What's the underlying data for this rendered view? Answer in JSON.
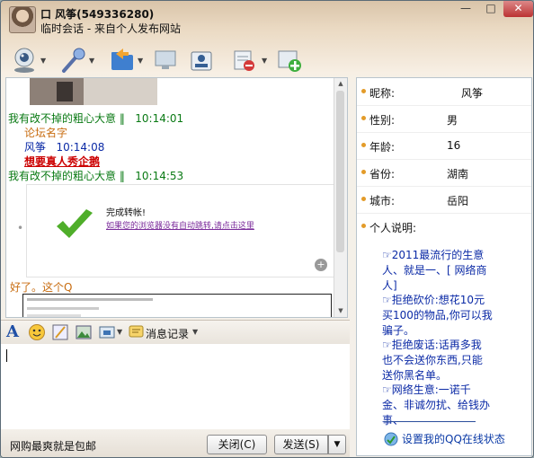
{
  "window": {
    "title_name": "口 风筝(549336280)",
    "subtitle": "临时会话 - 来自个人发布网站",
    "min_glyph": "—",
    "max_glyph": "□",
    "close_glyph": "✕"
  },
  "chat": {
    "messages": [
      {
        "sender": "我有改不掉的粗心大意 ‖",
        "time": "10:14:01"
      },
      {
        "text": "论坛名字"
      },
      {
        "sender": "风筝",
        "time": "10:14:08"
      },
      {
        "text": "想要真人秀企鹅"
      },
      {
        "sender": "我有改不掉的粗心大意 ‖",
        "time": "10:14:53"
      },
      {
        "text": "好了。这个Q"
      }
    ],
    "card": {
      "title": "完成转帐!",
      "link": "如果您的浏览器没有自动跳转,请点击这里"
    }
  },
  "format_toolbar": {
    "history_label": "消息记录"
  },
  "bottom": {
    "ad_text": "网购最爽就是包邮",
    "close_label": "关闭(C)",
    "send_label": "发送(S)"
  },
  "profile": {
    "nickname_label": "昵称:",
    "nickname": "风筝",
    "gender_label": "性别:",
    "gender": "男",
    "age_label": "年龄:",
    "age": "16",
    "province_label": "省份:",
    "province": "湖南",
    "city_label": "城市:",
    "city": "岳阳",
    "desc_label": "个人说明:",
    "desc_lines": [
      "☞2011最流行的生意",
      "人、就是一、[ 网络商",
      "人]",
      "☞拒绝砍价:想花10元",
      "买100的物品,你可以我",
      "骗子。",
      "☞拒绝废话:话再多我",
      "也不会送你东西,只能",
      "送你黑名单。",
      "☞网络生意:一诺千",
      "金、非诚勿扰、给钱办",
      "事、"
    ],
    "qq_status_link": "设置我的QQ在线状态"
  },
  "colors": {
    "self_sender": "#0a7a14",
    "other_sender": "#0b2aa6",
    "self_text": "#c86d11",
    "alert_text": "#cc0000"
  }
}
